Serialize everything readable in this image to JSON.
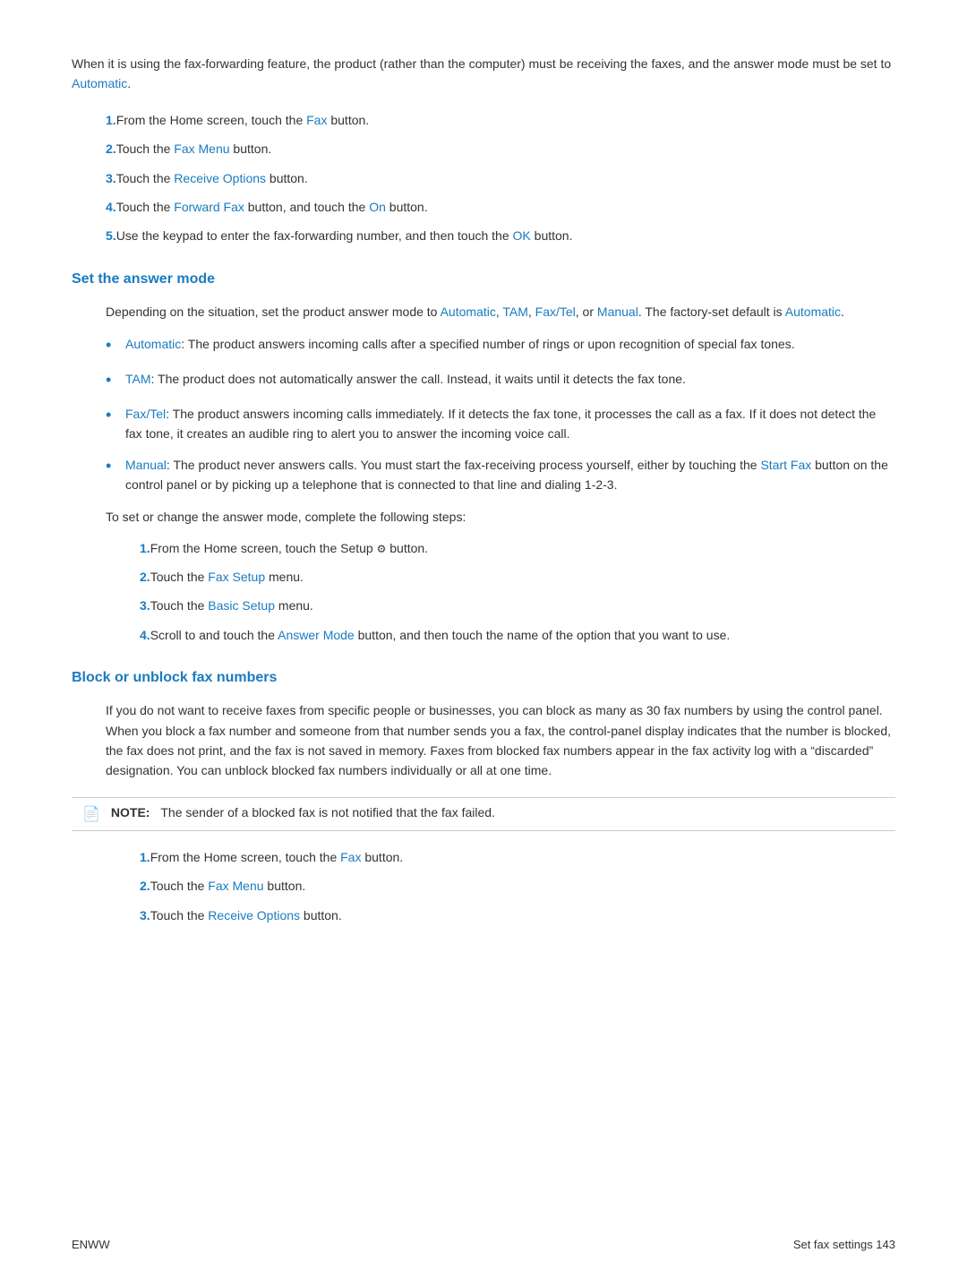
{
  "page": {
    "intro": {
      "text": "When it is using the fax-forwarding feature, the product (rather than the computer) must be receiving the faxes, and the answer mode must be set to ",
      "link": "Automatic",
      "end": "."
    },
    "forwarding_steps": [
      {
        "num": "1.",
        "text": "From the Home screen, touch the ",
        "link": "Fax",
        "link_label": "Fax",
        "end": " button."
      },
      {
        "num": "2.",
        "text": "Touch the ",
        "link": "Fax Menu",
        "end": " button."
      },
      {
        "num": "3.",
        "text": "Touch the ",
        "link": "Receive Options",
        "end": " button."
      },
      {
        "num": "4.",
        "text": "Touch the ",
        "link": "Forward Fax",
        "end": " button, and touch the ",
        "link2": "On",
        "end2": " button."
      },
      {
        "num": "5.",
        "text": "Use the keypad to enter the fax-forwarding number, and then touch the ",
        "link": "OK",
        "end": " button."
      }
    ],
    "section1": {
      "heading": "Set the answer mode",
      "intro": "Depending on the situation, set the product answer mode to ",
      "link1": "Automatic",
      "sep1": ", ",
      "link2": "TAM",
      "sep2": ", ",
      "link3": "Fax/Tel",
      "sep3": ", or ",
      "link4": "Manual",
      "end": ". The factory-set default is ",
      "link5": "Automatic",
      "end2": ".",
      "bullets": [
        {
          "link": "Automatic",
          "text": ": The product answers incoming calls after a specified number of rings or upon recognition of special fax tones."
        },
        {
          "link": "TAM",
          "text": ": The product does not automatically answer the call. Instead, it waits until it detects the fax tone."
        },
        {
          "link": "Fax/Tel",
          "text": ": The product answers incoming calls immediately. If it detects the fax tone, it processes the call as a fax. If it does not detect the fax tone, it creates an audible ring to alert you to answer the incoming voice call."
        },
        {
          "link": "Manual",
          "text": ": The product never answers calls. You must start the fax-receiving process yourself, either by touching the ",
          "link2": "Start Fax",
          "text2": " button on the control panel or by picking up a telephone that is connected to that line and dialing 1-2-3."
        }
      ],
      "steps_intro": "To set or change the answer mode, complete the following steps:",
      "steps": [
        {
          "num": "1.",
          "text": "From the Home screen, touch the Setup ",
          "gear": "⚙",
          "end": " button."
        },
        {
          "num": "2.",
          "text": "Touch the ",
          "link": "Fax Setup",
          "end": " menu."
        },
        {
          "num": "3.",
          "text": "Touch the ",
          "link": "Basic Setup",
          "end": " menu."
        },
        {
          "num": "4.",
          "text": "Scroll to and touch the ",
          "link": "Answer Mode",
          "end": " button, and then touch the name of the option that you want to use."
        }
      ]
    },
    "section2": {
      "heading": "Block or unblock fax numbers",
      "body": "If you do not want to receive faxes from specific people or businesses, you can block as many as 30 fax numbers by using the control panel. When you block a fax number and someone from that number sends you a fax, the control-panel display indicates that the number is blocked, the fax does not print, and the fax is not saved in memory. Faxes from blocked fax numbers appear in the fax activity log with a “discarded” designation. You can unblock blocked fax numbers individually or all at one time.",
      "note": {
        "icon": "📄",
        "label": "NOTE:",
        "text": "The sender of a blocked fax is not notified that the fax failed."
      },
      "steps": [
        {
          "num": "1.",
          "text": "From the Home screen, touch the ",
          "link": "Fax",
          "end": " button."
        },
        {
          "num": "2.",
          "text": "Touch the ",
          "link": "Fax Menu",
          "end": " button."
        },
        {
          "num": "3.",
          "text": "Touch the ",
          "link": "Receive Options",
          "end": " button."
        }
      ]
    },
    "footer": {
      "left": "ENWW",
      "right": "Set fax settings  143"
    }
  }
}
